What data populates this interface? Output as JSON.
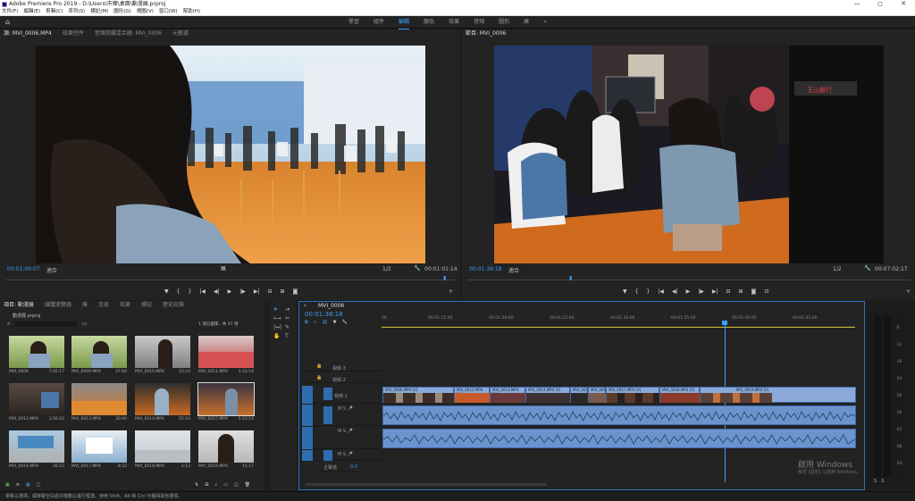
{
  "window": {
    "title": "Adobe Premiere Pro 2019 - D:\\Users\\市鄉\\桌面\\動漫展.prproj",
    "controls": [
      "—",
      "◻",
      "✕"
    ]
  },
  "menu": [
    "文件(F)",
    "編輯(E)",
    "剪輯(C)",
    "序列(S)",
    "標記(M)",
    "圖形(G)",
    "視圖(V)",
    "窗口(W)",
    "幫助(H)"
  ],
  "workspaces": {
    "items": [
      "學習",
      "組件",
      "編輯",
      "顏色",
      "效果",
      "音頻",
      "圖形",
      "庫"
    ],
    "active": 2,
    "more": "»"
  },
  "source": {
    "tabs": [
      "源: MVI_0006.MP4",
      "效果控件",
      "音頻剪輯混合器: MVI_0006",
      "元數據"
    ],
    "timecode_in": "00:01:00:07",
    "fit": "適合",
    "ratio": "1/2",
    "timecode_out": "00:01:01:14"
  },
  "program": {
    "tabs": [
      "節目: MVI_0006"
    ],
    "timecode_in": "00:01:38:18",
    "fit": "適合",
    "ratio": "1/2",
    "timecode_out": "00:07:02:17",
    "sign_text": "玉山銀行"
  },
  "project": {
    "tabs": [
      "項目: 動漫展",
      "媒體瀏覽器",
      "庫",
      "信息",
      "效果",
      "標記",
      "歷史記錄"
    ],
    "file": "動漫展.prproj",
    "selection": "1 項已選擇，共 37 項",
    "items": [
      {
        "name": "MVI_0006",
        "dur": "7:02:17"
      },
      {
        "name": "MVI_0009.MP4",
        "dur": "37:04"
      },
      {
        "name": "MVI_0010.MP4",
        "dur": "23:24"
      },
      {
        "name": "MVI_0011.MP4",
        "dur": "1:31:14"
      },
      {
        "name": "MVI_0012.MP4",
        "dur": "1:56:02"
      },
      {
        "name": "MVI_0013.MP4",
        "dur": "30:00"
      },
      {
        "name": "MVI_0014.MP4",
        "dur": "55:10"
      },
      {
        "name": "MVI_0015.MP4",
        "dur": "5:21:14"
      },
      {
        "name": "MVI_0016.MP4",
        "dur": "35:23"
      },
      {
        "name": "MVI_0017.MP4",
        "dur": "8:22"
      },
      {
        "name": "MVI_0018.MP4",
        "dur": "2:13"
      },
      {
        "name": "MVI_0019.MP4",
        "dur": "15:17"
      }
    ]
  },
  "timeline": {
    "tab": "MVI_0006",
    "timecode": "00:01:38:18",
    "ruler": [
      "00",
      "00:01:15:00",
      "00:01:20:00",
      "00:01:25:00",
      "00:01:30:00",
      "00:01:35:00",
      "00:01:40:00",
      "00:01:45:00"
    ],
    "tracks": [
      {
        "id": "V3",
        "label": "視頻 3"
      },
      {
        "id": "V2",
        "label": "視頻 2"
      },
      {
        "id": "V1",
        "label": "視頻 1"
      },
      {
        "id": "A1",
        "label": "音頻 1"
      },
      {
        "id": "A2",
        "label": "音頻 2"
      },
      {
        "id": "A3",
        "label": "音頻 3"
      },
      {
        "id": "M",
        "label": "主聲道",
        "value": "0.0"
      }
    ],
    "clips": [
      "MVI_0006.MP4 [V]",
      "MVI_0012.MP4 [V]",
      "MVI_0013.MP4 [V]",
      "MVI_0014.MP4 [V]",
      "MVI_0015.MP4",
      "MVI_0016.MP4",
      "MVI_0017.MP4 [V]",
      "MVI_0018.MP4 [V]",
      "MVI_0019.MP4 [V]"
    ]
  },
  "meter": {
    "labels": [
      "-6",
      "-12",
      "-18",
      "-24",
      "-30",
      "-36",
      "-42",
      "-48",
      "-54"
    ],
    "solo": [
      "S",
      "S"
    ]
  },
  "watermark": {
    "line1": "啟用 Windows",
    "line2": "移至 [設定] 以啟用 Windows。"
  },
  "status": "單擊以選擇，或單擊空白處并拖動以進行框選。使用 Shift、Alt 和 Ctrl 可獲得其他選項。",
  "colors": {
    "accent": "#3ca0ff",
    "clip_video": "#8aa9d8",
    "clip_audio": "#6b94cf",
    "playhead": "#3ca0ff",
    "timecode": "#3d9cf5"
  }
}
